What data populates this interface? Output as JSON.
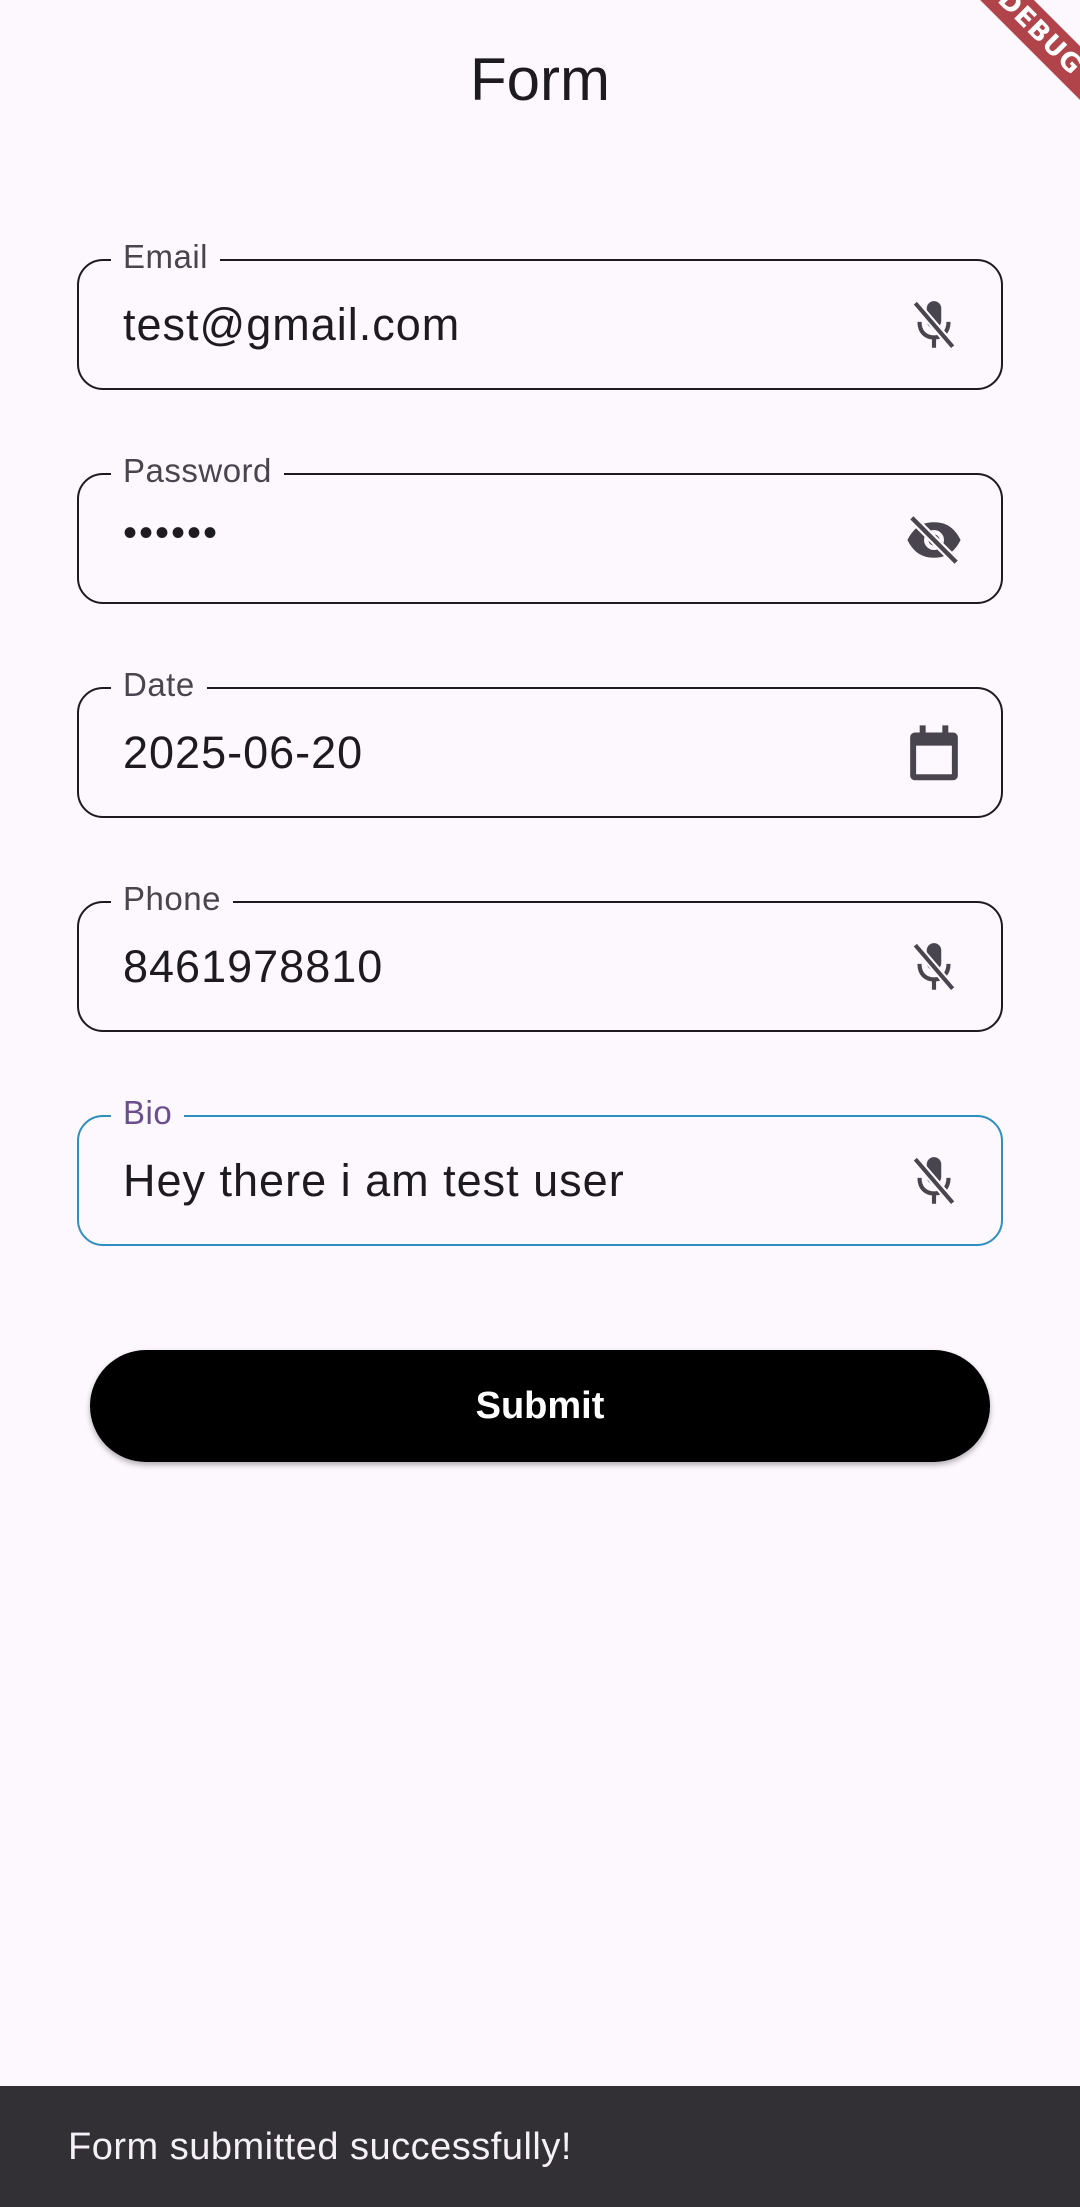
{
  "app_bar": {
    "title": "Form",
    "debug_banner": "DEBUG"
  },
  "form": {
    "fields": [
      {
        "label": "Email",
        "value": "test@gmail.com",
        "icon": "mic-off-icon"
      },
      {
        "label": "Password",
        "value": "••••••",
        "icon": "visibility-off-icon"
      },
      {
        "label": "Date",
        "value": "2025-06-20",
        "icon": "calendar-icon"
      },
      {
        "label": "Phone",
        "value": "8461978810",
        "icon": "mic-off-icon"
      },
      {
        "label": "Bio",
        "value": "Hey there i am test user",
        "icon": "mic-off-icon",
        "focused": true
      }
    ],
    "submit_label": "Submit"
  },
  "snackbar": {
    "message": "Form submitted successfully!"
  },
  "colors": {
    "background": "#fdf7fe",
    "focus_border": "#2e8fbf",
    "button": "#000000",
    "snackbar": "#322f35",
    "debug_banner": "#b0444a"
  }
}
